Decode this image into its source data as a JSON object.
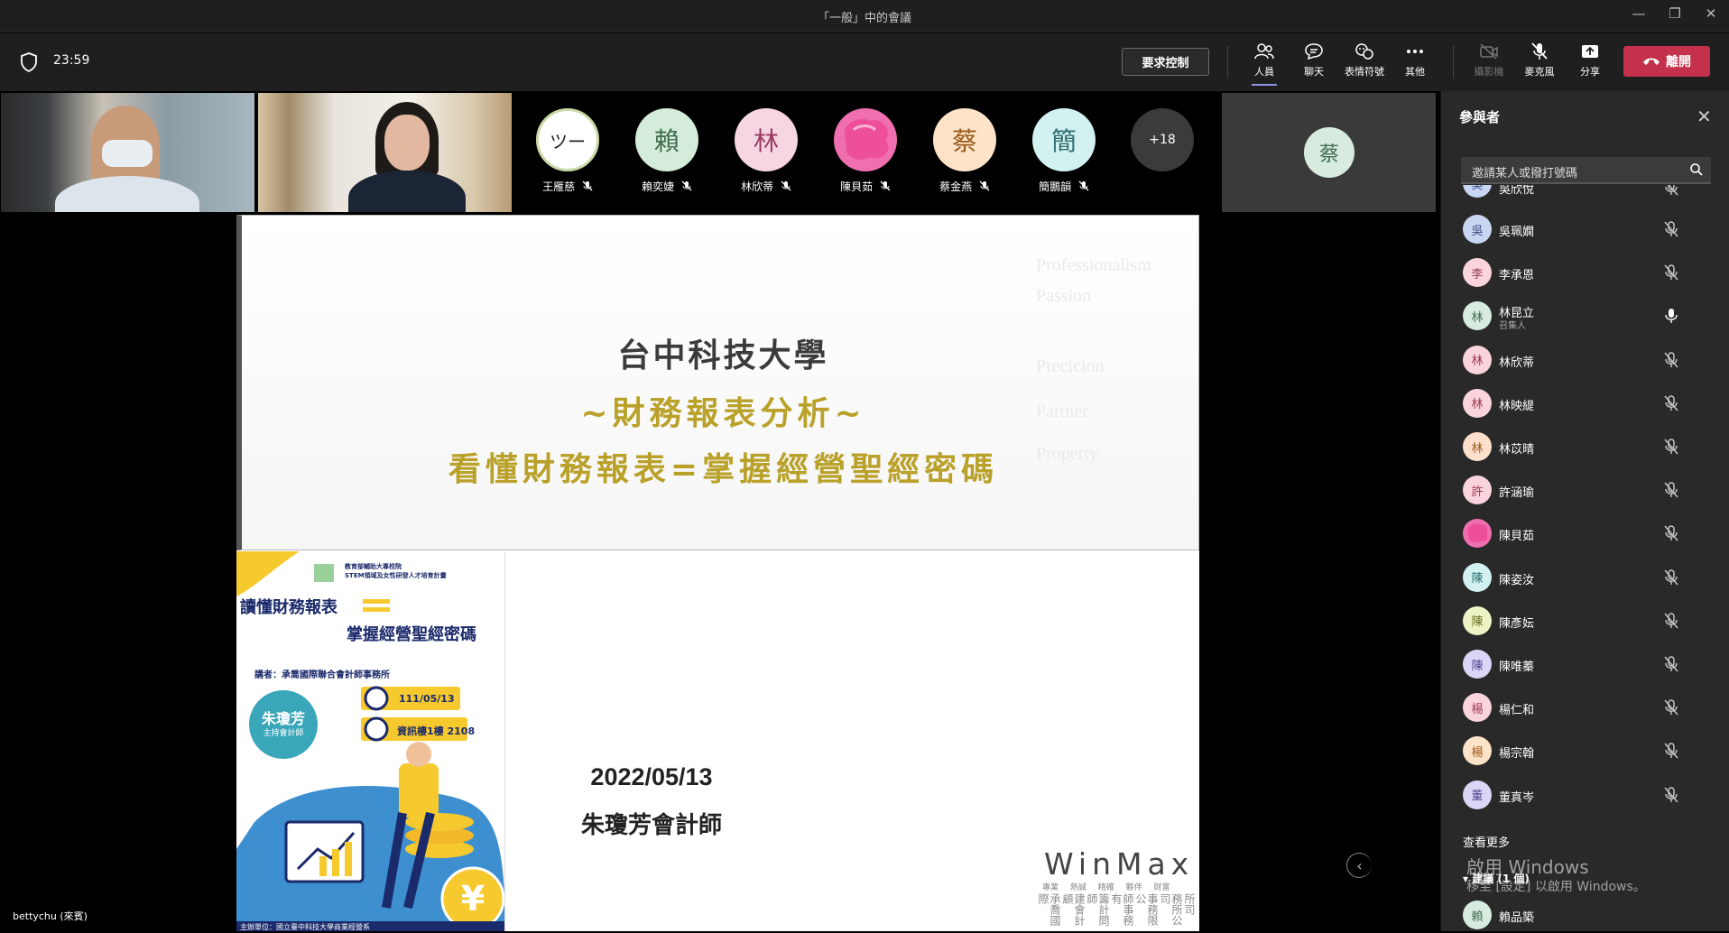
{
  "window": {
    "title": "「一般」中的會議"
  },
  "toolbar": {
    "timer": "23:59",
    "request_control": "要求控制",
    "people": "人員",
    "chat": "聊天",
    "reactions": "表情符號",
    "more": "其他",
    "camera": "攝影機",
    "mic": "麥克風",
    "share": "分享",
    "leave": "離開"
  },
  "video": {
    "self_name": "bettychu (來賓)"
  },
  "avatars": [
    {
      "initial": "ツー",
      "name": "王雁慈",
      "bg": "#ffffff",
      "fg": "#222222"
    },
    {
      "initial": "賴",
      "name": "賴奕婕",
      "bg": "#d4ecd9",
      "fg": "#3e6a4e"
    },
    {
      "initial": "林",
      "name": "林欣蒂",
      "bg": "#f7d6e4",
      "fg": "#9c3a62"
    },
    {
      "initial": "",
      "name": "陳貝茹",
      "bg": "#f06fb0",
      "fg": "#ffffff"
    },
    {
      "initial": "蔡",
      "name": "蔡金燕",
      "bg": "#fde4c8",
      "fg": "#9a5b1e"
    },
    {
      "initial": "簡",
      "name": "簡鵬韻",
      "bg": "#d3f1f1",
      "fg": "#2f6f70"
    }
  ],
  "overflow_count": "+18",
  "tile": {
    "initial": "蔡"
  },
  "slide": {
    "line1": "台中科技大學",
    "line2": "~財務報表分析~",
    "line3": "看懂財務報表=掌握經營聖經密碼",
    "watermarks": [
      "Professionalism",
      "Passion",
      "Precicion",
      "Partner",
      "Property"
    ],
    "date": "2022/05/13",
    "presenter": "朱瓊芳會計師",
    "brand": "WinMax",
    "brand_sub": "專業 熱誠 精確 夥伴 財富",
    "firm_cols": [
      "承喬國際",
      "建會計顧",
      "籌計問師",
      "師事務有",
      "事務限公",
      "務所公司",
      "所司"
    ]
  },
  "poster": {
    "org": "教育部輔助大專校院",
    "program": "STEM領域及女性研發人才培育計畫",
    "title1": "讀懂財務報表",
    "title2": "掌握經營聖經密碼",
    "speaker_label": "講者：承喬國際聯合會計師事務所",
    "name": "朱瓊芳",
    "role": "主持會計師",
    "date": "111/05/13",
    "room": "資訊樓1樓 2108",
    "host": "主辦單位：國立臺中科技大學商業經營系"
  },
  "panel": {
    "title": "參與者",
    "search_placeholder": "邀請某人或撥打號碼",
    "participants": [
      {
        "initial": "吳",
        "name": "吳欣悅",
        "bg": "#c9d6f2",
        "fg": "#3a4f86",
        "muted": true
      },
      {
        "initial": "吳",
        "name": "吳珮嫻",
        "bg": "#c9d6f2",
        "fg": "#3a4f86",
        "muted": true
      },
      {
        "initial": "李",
        "name": "李承恩",
        "bg": "#f9d4dc",
        "fg": "#9c3a52",
        "muted": true
      },
      {
        "initial": "林",
        "name": "林昆立",
        "sub": "召集人",
        "bg": "#d7ecdf",
        "fg": "#3e6a4e",
        "muted": false
      },
      {
        "initial": "林",
        "name": "林欣蒂",
        "bg": "#f9d4dc",
        "fg": "#9c3a52",
        "muted": true
      },
      {
        "initial": "林",
        "name": "林映緹",
        "bg": "#f9d4dc",
        "fg": "#9c3a52",
        "muted": true
      },
      {
        "initial": "林",
        "name": "林苡晴",
        "bg": "#fde0cc",
        "fg": "#9a5b1e",
        "muted": true
      },
      {
        "initial": "許",
        "name": "許涵瑜",
        "bg": "#f9d4dc",
        "fg": "#9c3a52",
        "muted": true
      },
      {
        "initial": "",
        "name": "陳貝茹",
        "bg": "#f06fb0",
        "fg": "#ffffff",
        "muted": true
      },
      {
        "initial": "陳",
        "name": "陳姿汝",
        "bg": "#d3f1f1",
        "fg": "#2f6f70",
        "muted": true
      },
      {
        "initial": "陳",
        "name": "陳彥妘",
        "bg": "#eef3c6",
        "fg": "#6a6f20",
        "muted": true
      },
      {
        "initial": "陳",
        "name": "陳唯蓁",
        "bg": "#dcd6f6",
        "fg": "#4e3f8a",
        "muted": true
      },
      {
        "initial": "楊",
        "name": "楊仁和",
        "bg": "#f9d4dc",
        "fg": "#9c3a52",
        "muted": true
      },
      {
        "initial": "楊",
        "name": "楊宗翰",
        "bg": "#fde4c8",
        "fg": "#9a5b1e",
        "muted": true
      },
      {
        "initial": "董",
        "name": "董真岑",
        "bg": "#dcd6f6",
        "fg": "#4e3f8a",
        "muted": true
      }
    ],
    "see_more": "查看更多",
    "suggested": "建議 (1 個)",
    "suggested_person": {
      "initial": "賴",
      "name": "賴品築",
      "bg": "#d7ecdf",
      "fg": "#3e6a4e"
    }
  },
  "activation": {
    "title": "啟用 Windows",
    "sub": "移至 [設定] 以啟用 Windows。"
  }
}
